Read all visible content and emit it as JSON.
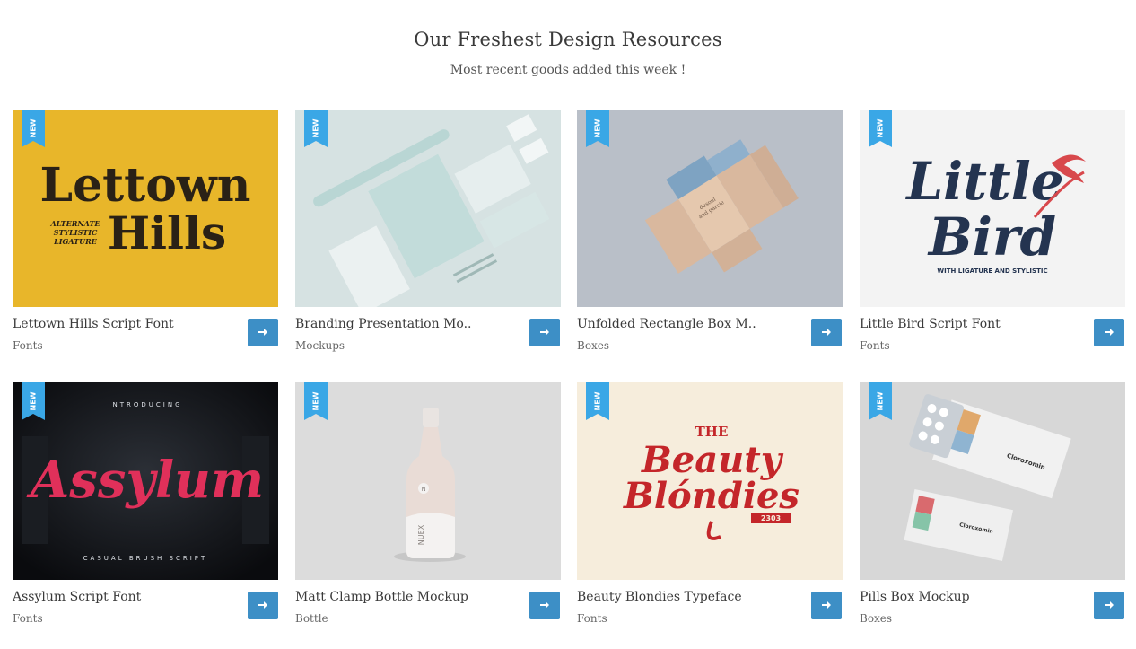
{
  "section": {
    "title": "Our Freshest Design Resources",
    "subtitle": "Most recent goods added this week !"
  },
  "badge_label": "NEW",
  "colors": {
    "accent": "#3d8fc6",
    "ribbon": "#3aa7e6"
  },
  "products": [
    {
      "title": "Lettown Hills Script Font",
      "category": "Fonts",
      "thumb_text": [
        "Lettown",
        "Hills",
        "ALTERNATE",
        "STYLISTIC",
        "LIGATURE"
      ]
    },
    {
      "title": "Branding Presentation Mo..",
      "category": "Mockups"
    },
    {
      "title": "Unfolded Rectangle Box M..",
      "category": "Boxes",
      "thumb_text": [
        "dusoul",
        "and garcie"
      ]
    },
    {
      "title": "Little Bird Script Font",
      "category": "Fonts",
      "thumb_text": [
        "Little",
        "Bird",
        "WITH LIGATURE AND STYLISTIC"
      ]
    },
    {
      "title": "Assylum Script Font",
      "category": "Fonts",
      "thumb_text": [
        "INTRODUCING",
        "Assylum",
        "CASUAL BRUSH SCRIPT"
      ]
    },
    {
      "title": "Matt Clamp Bottle Mockup",
      "category": "Bottle",
      "thumb_text": [
        "NUEX",
        "N"
      ]
    },
    {
      "title": "Beauty Blondies Typeface",
      "category": "Fonts",
      "thumb_text": [
        "THE",
        "Beauty",
        "Blóndies",
        "2303"
      ]
    },
    {
      "title": "Pills Box Mockup",
      "category": "Boxes",
      "thumb_text": [
        "Cloroxomin",
        "Cloroxomin"
      ]
    }
  ],
  "icons": {
    "button": "arrow-right-icon",
    "badge": "new-ribbon-icon"
  }
}
